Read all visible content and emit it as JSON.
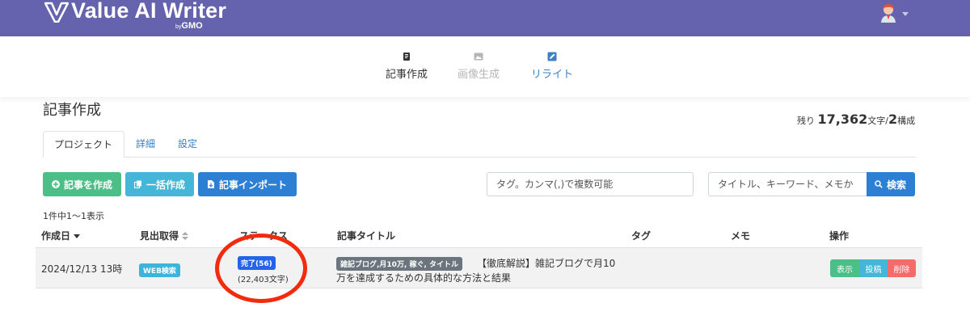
{
  "header": {
    "brand_name": "Value AI Writer",
    "brand_by": "by",
    "brand_company": "GMO",
    "accent_color": "#6563ad"
  },
  "nav": {
    "items": [
      {
        "label": "記事作成",
        "icon": "document-icon",
        "state": "active"
      },
      {
        "label": "画像生成",
        "icon": "image-icon",
        "state": "disabled"
      },
      {
        "label": "リライト",
        "icon": "edit-icon",
        "state": "link"
      }
    ]
  },
  "page": {
    "title": "記事作成",
    "remaining_prefix": "残り",
    "remaining_chars": "17,362",
    "remaining_chars_unit": "文字/",
    "remaining_structures": "2",
    "remaining_structures_unit": "構成"
  },
  "tabs": [
    {
      "label": "プロジェクト",
      "active": true
    },
    {
      "label": "詳細",
      "active": false
    },
    {
      "label": "設定",
      "active": false
    }
  ],
  "toolbar": {
    "create_label": "記事を作成",
    "bulk_label": "一括作成",
    "import_label": "記事インポート",
    "tag_placeholder": "タグ。カンマ(,)で複数可能",
    "search_placeholder": "タイトル、キーワード、メモか",
    "search_label": "検索"
  },
  "list": {
    "count_text": "1件中1〜1表示",
    "columns": [
      "作成日",
      "見出取得",
      "ステータス",
      "記事タイトル",
      "タグ",
      "メモ",
      "操作"
    ],
    "rows": [
      {
        "date": "2024/12/13 13時",
        "heading_source": "WEB検索",
        "status": "完了(56)",
        "chars": "(22,403文字)",
        "tag_badge": "雑記ブログ,月10万, 稼ぐ, タイトル",
        "title_line1": "【徹底解説】雑記ブログで月10",
        "title_line2": "万を達成するための具体的な方法と結果",
        "actions": [
          "表示",
          "投稿",
          "削除"
        ]
      }
    ]
  }
}
